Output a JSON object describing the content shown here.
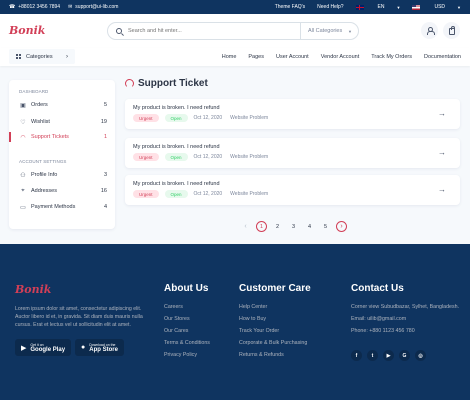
{
  "topbar": {
    "phone": "+88012 3456 7894",
    "email": "support@ui-lib.com",
    "faq": "Theme FAQ's",
    "help": "Need Help?",
    "language": "EN",
    "currency": "USD"
  },
  "header": {
    "logo": "Bonik",
    "search_placeholder": "Search and hit enter...",
    "category_select": "All Categories"
  },
  "nav": {
    "categories_label": "Categories",
    "links": [
      "Home",
      "Pages",
      "User Account",
      "Vendor Account",
      "Track My Orders",
      "Documentation"
    ]
  },
  "sidebar": {
    "dashboard_heading": "DASHBOARD",
    "dashboard_items": [
      {
        "label": "Orders",
        "count": "5",
        "icon": "bag-icon"
      },
      {
        "label": "Wishlist",
        "count": "19",
        "icon": "heart-icon"
      },
      {
        "label": "Support Tickets",
        "count": "1",
        "icon": "headset-icon",
        "active": true
      }
    ],
    "account_heading": "ACCOUNT SETTINGS",
    "account_items": [
      {
        "label": "Profile Info",
        "count": "3",
        "icon": "person-icon"
      },
      {
        "label": "Addresses",
        "count": "16",
        "icon": "location-icon"
      },
      {
        "label": "Payment Methods",
        "count": "4",
        "icon": "card-icon"
      }
    ]
  },
  "main": {
    "title": "Support Ticket",
    "tickets": [
      {
        "title": "My product is broken. I need refund",
        "priority": "Urgent",
        "status": "Open",
        "date": "Oct 12, 2020",
        "category": "Website Problem"
      },
      {
        "title": "My product is broken. I need refund",
        "priority": "Urgent",
        "status": "Open",
        "date": "Oct 12, 2020",
        "category": "Website Problem"
      },
      {
        "title": "My product is broken. I need refund",
        "priority": "Urgent",
        "status": "Open",
        "date": "Oct 12, 2020",
        "category": "Website Problem"
      }
    ],
    "pagination": {
      "pages": [
        "1",
        "2",
        "3",
        "4",
        "5"
      ],
      "current": "1"
    }
  },
  "footer": {
    "logo": "Bonik",
    "description": "Lorem ipsum dolor sit amet, consectetur adipiscing elit. Auctor libero id et, in gravida. Sit diam duis mauris nulla cursus. Erat et lectus vel ut sollicitudin elit at amet.",
    "google_play": {
      "small": "Get it on",
      "big": "Google Play"
    },
    "app_store": {
      "small": "Download on the",
      "big": "App Store"
    },
    "about": {
      "heading": "About Us",
      "links": [
        "Careers",
        "Our Stores",
        "Our Cares",
        "Terms & Conditions",
        "Privacy Policy"
      ]
    },
    "care": {
      "heading": "Customer Care",
      "links": [
        "Help Center",
        "How to Buy",
        "Track Your Order",
        "Corporate & Bulk Purchasing",
        "Returns & Refunds"
      ]
    },
    "contact": {
      "heading": "Contact Us",
      "address": "Corner view Subudbazar, Sylhet, Bangladesh.",
      "email": "Email: uilib@gmail.com",
      "phone": "Phone: +880 1123 456 780"
    },
    "socials": [
      {
        "icon": "facebook-icon",
        "glyph": "f"
      },
      {
        "icon": "twitter-icon",
        "glyph": "t"
      },
      {
        "icon": "youtube-icon",
        "glyph": "▶"
      },
      {
        "icon": "google-icon",
        "glyph": "G"
      },
      {
        "icon": "instagram-icon",
        "glyph": "◎"
      }
    ]
  },
  "colors": {
    "brand": "#d23f57",
    "navy": "#0f3460",
    "page_bg": "#f6f9fc",
    "text": "#2b3445"
  }
}
